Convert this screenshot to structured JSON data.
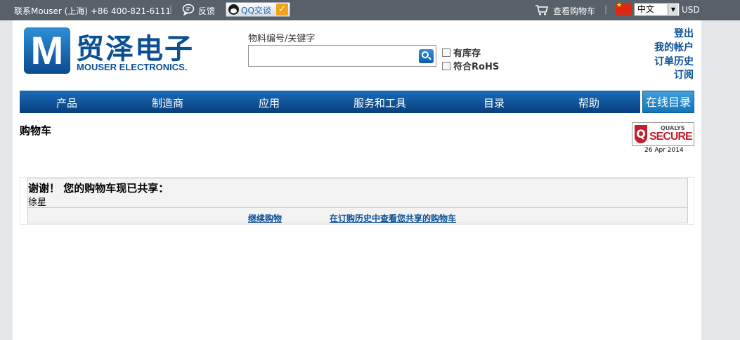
{
  "topbar": {
    "contact": "联系Mouser (上海)  +86 400-821-6111",
    "feedback": "反馈",
    "qq_chat": "QQ交谈",
    "view_cart": "查看购物车",
    "language": "中文",
    "currency": "USD"
  },
  "logo": {
    "cn": "贸泽电子",
    "en": "MOUSER ELECTRONICS.",
    "mark": "M"
  },
  "search": {
    "label": "物料编号/关键字",
    "value": "",
    "in_stock": "有库存",
    "rohs": "符合RoHS"
  },
  "account": {
    "logout": "登出",
    "my_account": "我的帐户",
    "order_history": "订单历史",
    "subscribe": "订阅"
  },
  "nav": {
    "items": [
      "产品",
      "制造商",
      "应用",
      "服务和工具",
      "目录",
      "帮助"
    ],
    "online_catalog": "在线目录"
  },
  "page": {
    "title": "购物车"
  },
  "qualys": {
    "brand": "QUALYS",
    "secure": "SECURE",
    "q": "Q",
    "date": "26 Apr 2014"
  },
  "message": {
    "title": "谢谢！  您的购物车现已共享：",
    "user": "徐星",
    "continue_shopping": "继续购物",
    "view_shared": "在订购历史中查看您共享的购物车"
  },
  "colors": {
    "brand_blue": "#0b4f95",
    "topbar": "#58606a",
    "nav_top": "#1c6cb8",
    "nav_bottom": "#073f7e"
  }
}
